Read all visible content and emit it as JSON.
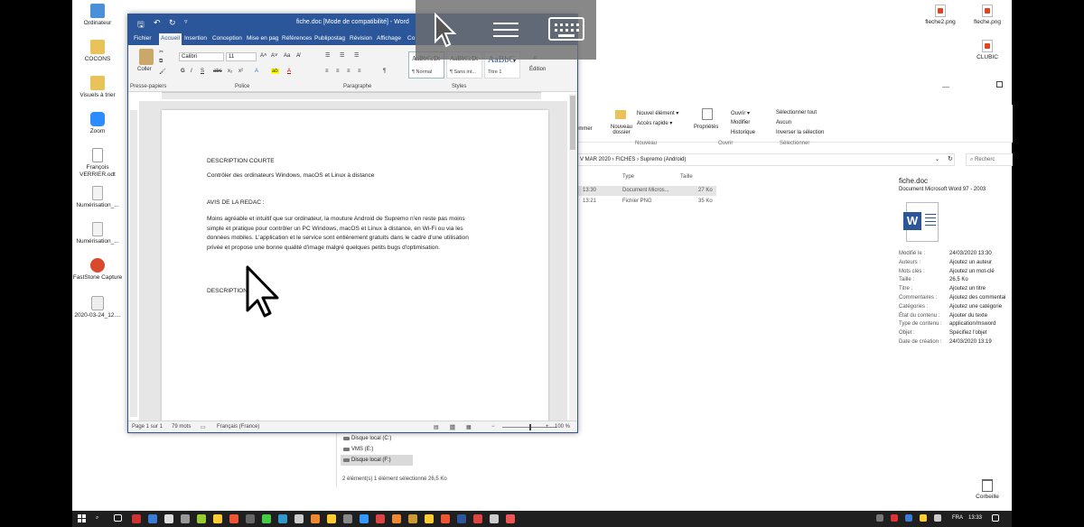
{
  "desktop": {
    "left_icons": [
      "Ordinateur",
      "COCONS",
      "Visuels à trier",
      "Zoom",
      "François VERRIER.odt",
      "Numérisation_...",
      "Numérisation_...",
      "FastStone Capture",
      "2020-03-24_12...."
    ],
    "right_icons": [
      "fleche2.png",
      "fleche.png",
      "CLUBIC"
    ],
    "recycle_bin": "Corbeille"
  },
  "word": {
    "title": "fiche.doc [Mode de compatibilité] - Word",
    "tabs": [
      "Fichier",
      "Accueil",
      "Insertion",
      "Conception",
      "Mise en pag",
      "Références",
      "Publipostag",
      "Révision",
      "Affichage",
      "Co"
    ],
    "active_tab": "Accueil",
    "ribbon": {
      "paste": "Coller",
      "font_name": "Calibri",
      "font_size": "11",
      "groups": [
        "Presse-papiers",
        "Police",
        "Paragraphe",
        "Styles"
      ],
      "styles": [
        {
          "sample": "AaBbCcDt",
          "name": "¶ Normal"
        },
        {
          "sample": "AaBbCcDt",
          "name": "¶ Sans int..."
        },
        {
          "sample": "AaBbC",
          "name": "Titre 1"
        }
      ],
      "edition": "Édition",
      "font_buttons": [
        "G",
        "I",
        "S",
        "abc",
        "x₂",
        "x²"
      ]
    },
    "document": {
      "heading1": "DESCRIPTION COURTE",
      "line1": "Contrôler des ordinateurs Windows, macOS et Linux à distance",
      "heading2": "AVIS DE LA REDAC :",
      "paragraph": [
        "Moins agréable et intuitif que sur ordinateur, la mouture Android de Supremo n'en reste pas moins",
        "simple et pratique pour contrôler un PC Windows, macOS et Linux à distance, en Wi-Fi ou via les",
        "données mobiles. L'application et le service sont entièrement gratuits dans le cadre d'une utilisation",
        "privée et propose une bonne qualité d'image malgré quelques petits bugs d'optimisation."
      ],
      "heading3": "DESCRIPTION"
    },
    "status": {
      "page": "Page 1 sur 1",
      "words": "79 mots",
      "language": "Français (France)",
      "zoom": "100 %"
    }
  },
  "explorer": {
    "ribbon": {
      "items": [
        "Nouvel élément ▾",
        "Accès rapide ▾",
        "Nouveau dossier",
        "Propriétés",
        "Ouvrir ▾",
        "Modifier",
        "Historique",
        "Sélectionner tout",
        "Aucun",
        "Inverser la sélection",
        "ommer"
      ],
      "groups": [
        "Nouveau",
        "Ouvrir",
        "Sélectionner"
      ]
    },
    "path": "V MAR 2020  ›  FICHES  ›  Supremo (Android)",
    "search_placeholder": "Recherc",
    "columns": [
      "Type",
      "Taille"
    ],
    "files": [
      {
        "time": "13:30",
        "type": "Document Micros...",
        "size": "27 Ko"
      },
      {
        "time": "13:21",
        "type": "Fichier PNG",
        "size": "35 Ko"
      }
    ],
    "tree": [
      "Disque local (C:)",
      "VMS (E:)",
      "Disque local (F:)"
    ],
    "status": "2 élément(s)      1 élément sélectionné  26,5 Ko",
    "details": {
      "filename": "fiche.doc",
      "filetype": "Document Microsoft Word 97 - 2003",
      "props": [
        [
          "Modifié le :",
          "24/03/2020 13:30"
        ],
        [
          "Auteurs :",
          "Ajoutez un auteur"
        ],
        [
          "Mots clés :",
          "Ajoutez un mot-clé"
        ],
        [
          "Taille :",
          "26,5 Ko"
        ],
        [
          "Titre :",
          "Ajoutez un titre"
        ],
        [
          "Commentaires :",
          "Ajoutez des commentai"
        ],
        [
          "Catégories :",
          "Ajoutez une catégorie"
        ],
        [
          "État du contenu :",
          "Ajouter du texte"
        ],
        [
          "Type de contenu :",
          "application/msword"
        ],
        [
          "Objet :",
          "Spécifiez l'objet"
        ],
        [
          "Date de création :",
          "24/03/2020 13:19"
        ]
      ]
    }
  },
  "taskbar": {
    "lang": "FRA",
    "time": "13:33"
  },
  "colors": {
    "word_blue": "#2b579a",
    "overlay": "#6e6e6e"
  }
}
